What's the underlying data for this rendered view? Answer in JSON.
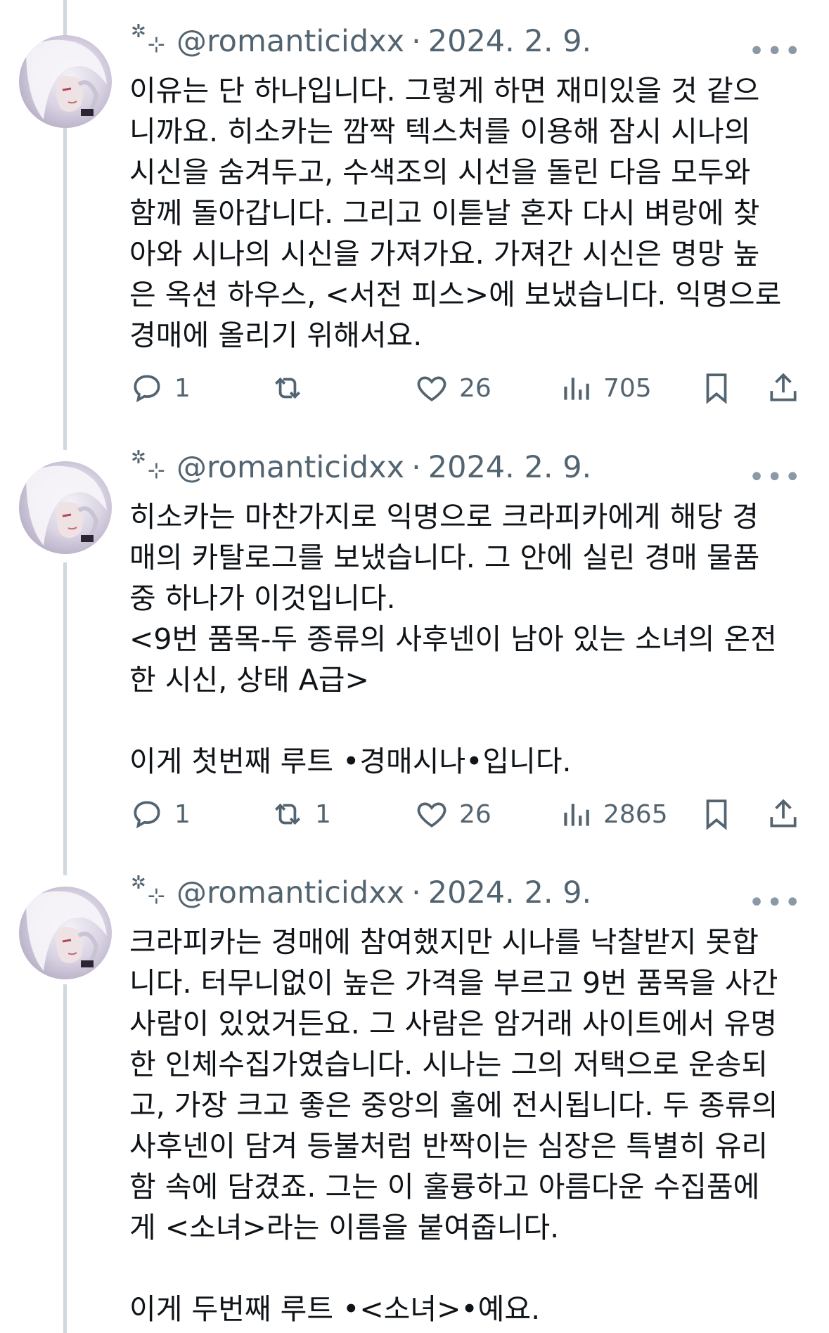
{
  "tweets": [
    {
      "handle": "@romanticidxx",
      "date": "2024. 2. 9.",
      "text": "이유는 단 하나입니다. 그렇게 하면 재미있을 것 같으\n니까요. 히소카는 깜짝 텍스처를 이용해 잠시 시나의\n시신을 숨겨두고, 수색조의 시선을 돌린 다음 모두와\n함께 돌아갑니다. 그리고 이튿날 혼자 다시 벼랑에 찾\n아와 시나의 시신을 가져가요. 가져간 시신은 명망 높\n은 옥션 하우스, <서전 피스>에 보냈습니다. 익명으로\n경매에 올리기 위해서요.",
      "replies": "1",
      "retweets": "",
      "likes": "26",
      "views": "705"
    },
    {
      "handle": "@romanticidxx",
      "date": "2024. 2. 9.",
      "text": "히소카는 마찬가지로 익명으로 크라피카에게 해당 경\n매의 카탈로그를 보냈습니다. 그 안에 실린 경매 물품\n중 하나가 이것입니다.\n<9번 품목-두 종류의 사후넨이 남아 있는 소녀의 온전\n한 시신, 상태 A급>\n\n이게 첫번째 루트 •경매시나•입니다.",
      "replies": "1",
      "retweets": "1",
      "likes": "26",
      "views": "2865"
    },
    {
      "handle": "@romanticidxx",
      "date": "2024. 2. 9.",
      "text": "크라피카는 경매에 참여했지만 시나를 낙찰받지 못합\n니다. 터무니없이 높은 가격을 부르고 9번 품목을 사간\n사람이 있었거든요. 그 사람은 암거래 사이트에서 유명\n한 인체수집가였습니다. 시나는 그의 저택으로 운송되\n고, 가장 크고 좋은 중앙의 홀에 전시됩니다. 두 종류의\n사후넨이 담겨 등불처럼 반짝이는 심장은 특별히 유리\n함 속에 담겼죠. 그는 이 훌륭하고 아름다운 수집품에\n게 <소녀>라는 이름을 붙여줍니다.\n\n이게 두번째 루트 •<소녀>•예요."
    }
  ],
  "icons": {
    "reply": "reply-icon",
    "retweet": "retweet-icon",
    "like": "heart-icon",
    "views": "views-icon",
    "bookmark": "bookmark-icon",
    "share": "share-icon",
    "more": "more-icon"
  },
  "symbols": {
    "sparkle_a": "✲",
    "sparkle_b": "⊹",
    "dot": "·",
    "more": "•••"
  }
}
